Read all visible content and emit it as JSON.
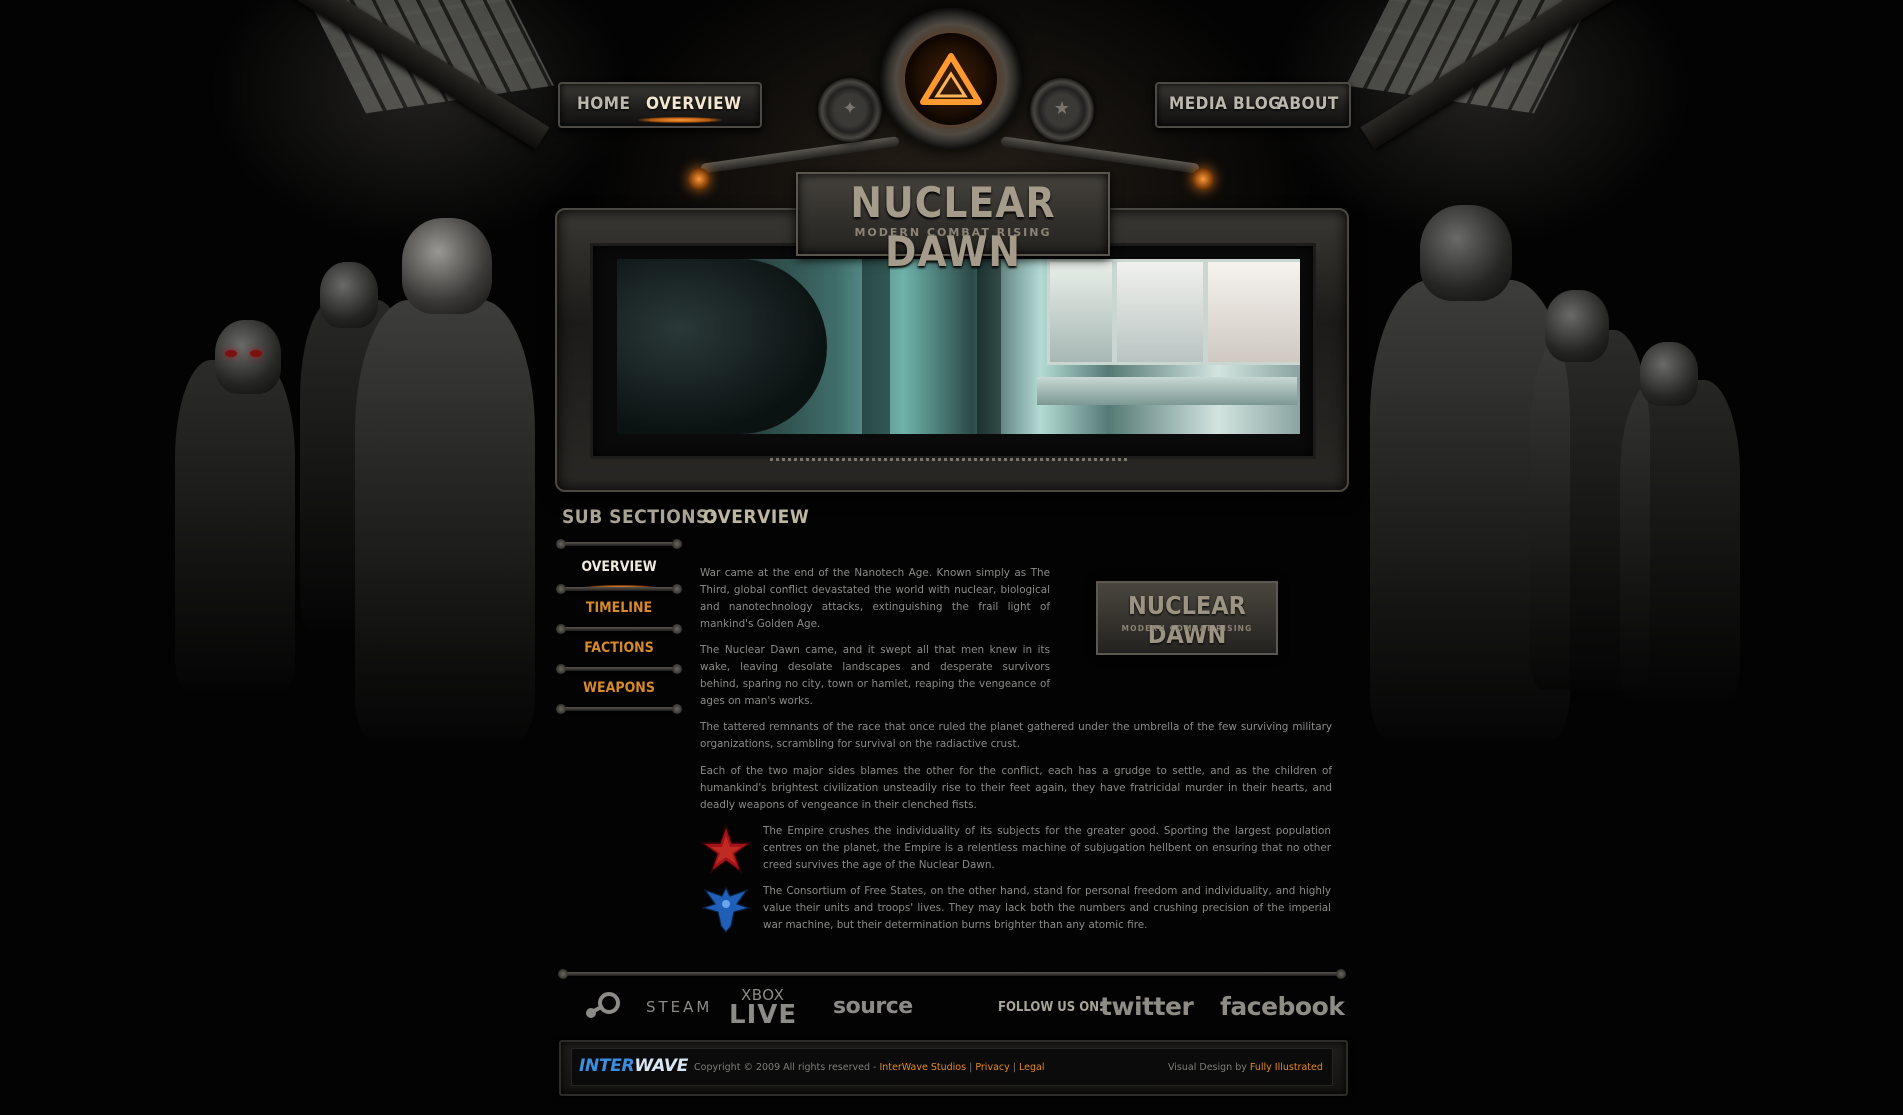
{
  "nav": {
    "left": [
      "HOME",
      "OVERVIEW"
    ],
    "right": [
      "MEDIA",
      "BLOG",
      "ABOUT"
    ],
    "active": "OVERVIEW"
  },
  "logo": {
    "title": "NUCLEAR DAWN",
    "subtitle": "MODERN COMBAT RISING"
  },
  "sidebar": {
    "heading": "SUB SECTIONS:",
    "items": [
      {
        "label": "OVERVIEW"
      },
      {
        "label": "TIMELINE"
      },
      {
        "label": "FACTIONS"
      },
      {
        "label": "WEAPONS"
      }
    ],
    "active": "OVERVIEW"
  },
  "content": {
    "heading": "OVERVIEW",
    "paragraphs": [
      "War came at the end of the Nanotech Age. Known simply as The Third, global conflict devastated the world with nuclear, biological and nanotechnology attacks, extinguishing the frail light of mankind's Golden Age.",
      "The Nuclear Dawn came, and it swept all that men knew in its wake, leaving desolate landscapes and desperate survivors behind, sparing no city, town or hamlet, reaping the vengeance of ages on man's works.",
      "The tattered remnants of the race that once ruled the planet gathered under the umbrella of the few surviving military organizations, scrambling for survival on the radiactive crust.",
      "Each of the two major sides blames the other for the conflict, each has a grudge to settle, and as the children of humankind's brightest civilization unsteadily rise to their feet again, they have fratricidal murder in their hearts, and deadly weapons of vengeance in their clenched fists."
    ],
    "factions": [
      {
        "icon": "empire-star-icon",
        "text": "The Empire crushes the individuality of its subjects for the greater good. Sporting the largest population centres on the planet, the Empire is a relentless machine of subjugation hellbent on ensuring that no other creed survives the age of the Nuclear Dawn."
      },
      {
        "icon": "consortium-phoenix-icon",
        "text": "The Consortium of Free States, on the other hand, stand for personal freedom and individuality, and highly value their units and troops' lives. They may lack both the numbers and crushing precision of the imperial war machine, but their determination burns brighter than any atomic fire."
      }
    ],
    "inline_logo": {
      "title": "NUCLEAR DAWN",
      "subtitle": "MODERN COMBAT RISING"
    }
  },
  "footer": {
    "partners": {
      "steam": "STEAM",
      "xbox_top": "XBOX",
      "xbox_bottom": "LIVE",
      "source": "source"
    },
    "follow_label": "FOLLOW US ON:",
    "social": {
      "twitter": "twitter",
      "facebook": "facebook"
    },
    "interwave_a": "INTER",
    "interwave_b": "WAVE",
    "copyright": "Copyright © 2009 All rights reserved -",
    "links": [
      "InterWave Studios",
      "Privacy",
      "Legal"
    ],
    "sep": "|",
    "visual_design_label": "Visual Design by",
    "visual_design_link": "Fully Illustrated",
    "colors": {
      "accent": "#e8891f",
      "interwave_blue": "#3a8fe0"
    }
  }
}
